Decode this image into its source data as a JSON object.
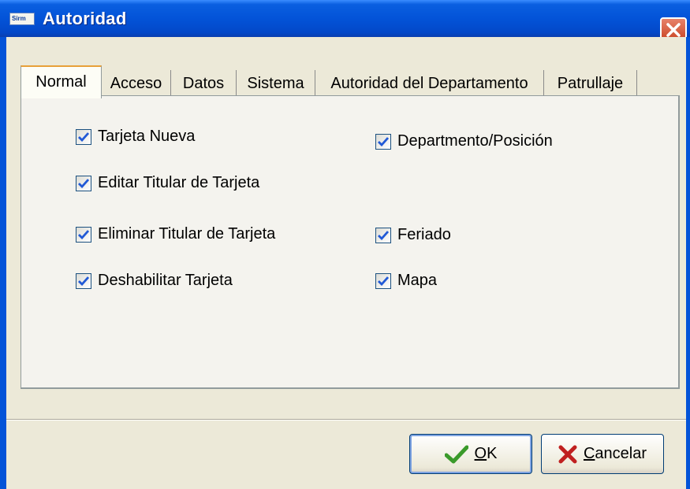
{
  "window": {
    "title": "Autoridad",
    "app_icon_text": "Sirm"
  },
  "tabs": [
    {
      "label": "Normal",
      "active": true
    },
    {
      "label": "Acceso",
      "active": false
    },
    {
      "label": "Datos",
      "active": false
    },
    {
      "label": "Sistema",
      "active": false
    },
    {
      "label": "Autoridad del Departamento",
      "active": false
    },
    {
      "label": "Patrullaje",
      "active": false
    }
  ],
  "checkboxes": {
    "tarjeta_nueva": {
      "label": "Tarjeta Nueva",
      "checked": true
    },
    "editar_titular": {
      "label": "Editar Titular de Tarjeta",
      "checked": true
    },
    "eliminar_titular": {
      "label": "Eliminar Titular de Tarjeta",
      "checked": true
    },
    "deshabilitar_tarjeta": {
      "label": "Deshabilitar Tarjeta",
      "checked": true
    },
    "departamento_posicion": {
      "label": "Departmento/Posición",
      "checked": true
    },
    "feriado": {
      "label": "Feriado",
      "checked": true
    },
    "mapa": {
      "label": "Mapa",
      "checked": true
    }
  },
  "buttons": {
    "ok": {
      "mnemonic": "O",
      "rest": "K",
      "icon": "checkmark-icon"
    },
    "cancel": {
      "mnemonic": "C",
      "rest": "ancelar",
      "icon": "x-icon"
    }
  },
  "colors": {
    "titlebar": "#0353d8",
    "close_button": "#d0502e",
    "checkmark": "#2159d6",
    "ok_icon": "#3a9a2a",
    "cancel_icon": "#c02020"
  }
}
